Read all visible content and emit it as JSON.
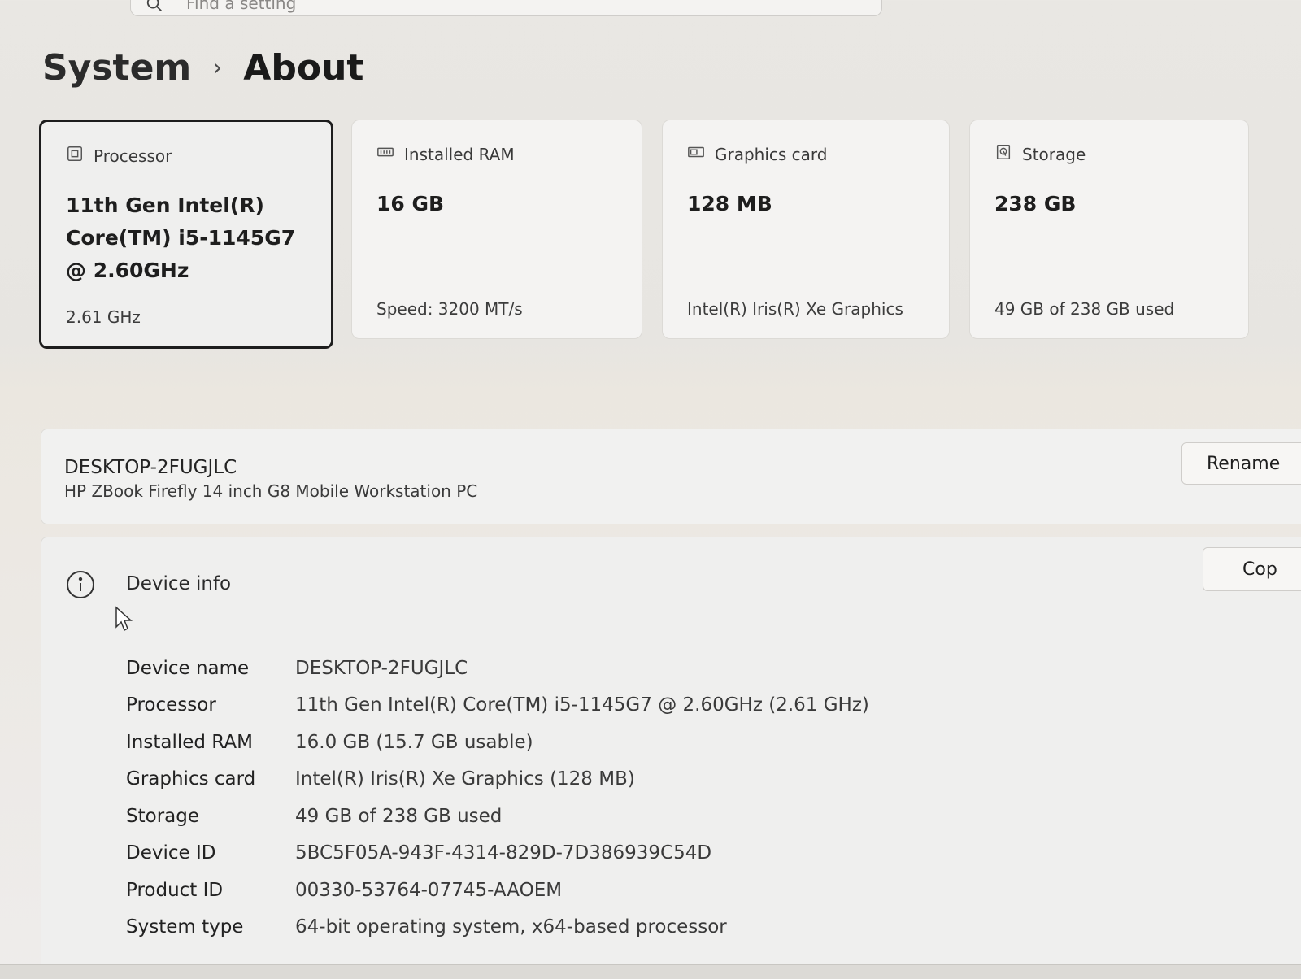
{
  "search": {
    "placeholder": "Find a setting",
    "icon": "search-icon"
  },
  "breadcrumb": {
    "parent": "System",
    "separator": "›",
    "current": "About"
  },
  "cards": [
    {
      "id": "processor",
      "icon": "processor-icon",
      "label": "Processor",
      "value": "11th Gen Intel(R) Core(TM) i5-1145G7 @ 2.60GHz",
      "sub": "2.61 GHz",
      "selected": true
    },
    {
      "id": "ram",
      "icon": "ram-icon",
      "label": "Installed RAM",
      "value": "16 GB",
      "sub": "Speed: 3200 MT/s"
    },
    {
      "id": "graphics",
      "icon": "graphics-card-icon",
      "label": "Graphics card",
      "value": "128 MB",
      "sub": "Intel(R) Iris(R) Xe Graphics"
    },
    {
      "id": "storage",
      "icon": "storage-icon",
      "label": "Storage",
      "value": "238 GB",
      "sub": "49 GB of 238 GB used"
    }
  ],
  "device": {
    "name": "DESKTOP-2FUGJLC",
    "model": "HP ZBook Firefly 14 inch G8 Mobile Workstation PC",
    "rename_label": "Rename"
  },
  "device_info": {
    "title": "Device info",
    "copy_label": "Cop",
    "specs": [
      {
        "label": "Device name",
        "value": "DESKTOP-2FUGJLC"
      },
      {
        "label": "Processor",
        "value": "11th Gen Intel(R) Core(TM) i5-1145G7 @ 2.60GHz (2.61 GHz)"
      },
      {
        "label": "Installed RAM",
        "value": "16.0 GB (15.7 GB usable)"
      },
      {
        "label": "Graphics card",
        "value": "Intel(R) Iris(R) Xe Graphics (128 MB)"
      },
      {
        "label": "Storage",
        "value": "49 GB of 238 GB used"
      },
      {
        "label": "Device ID",
        "value": "5BC5F05A-943F-4314-829D-7D386939C54D"
      },
      {
        "label": "Product ID",
        "value": "00330-53764-07745-AAOEM"
      },
      {
        "label": "System type",
        "value": "64-bit operating system, x64-based processor"
      }
    ]
  }
}
